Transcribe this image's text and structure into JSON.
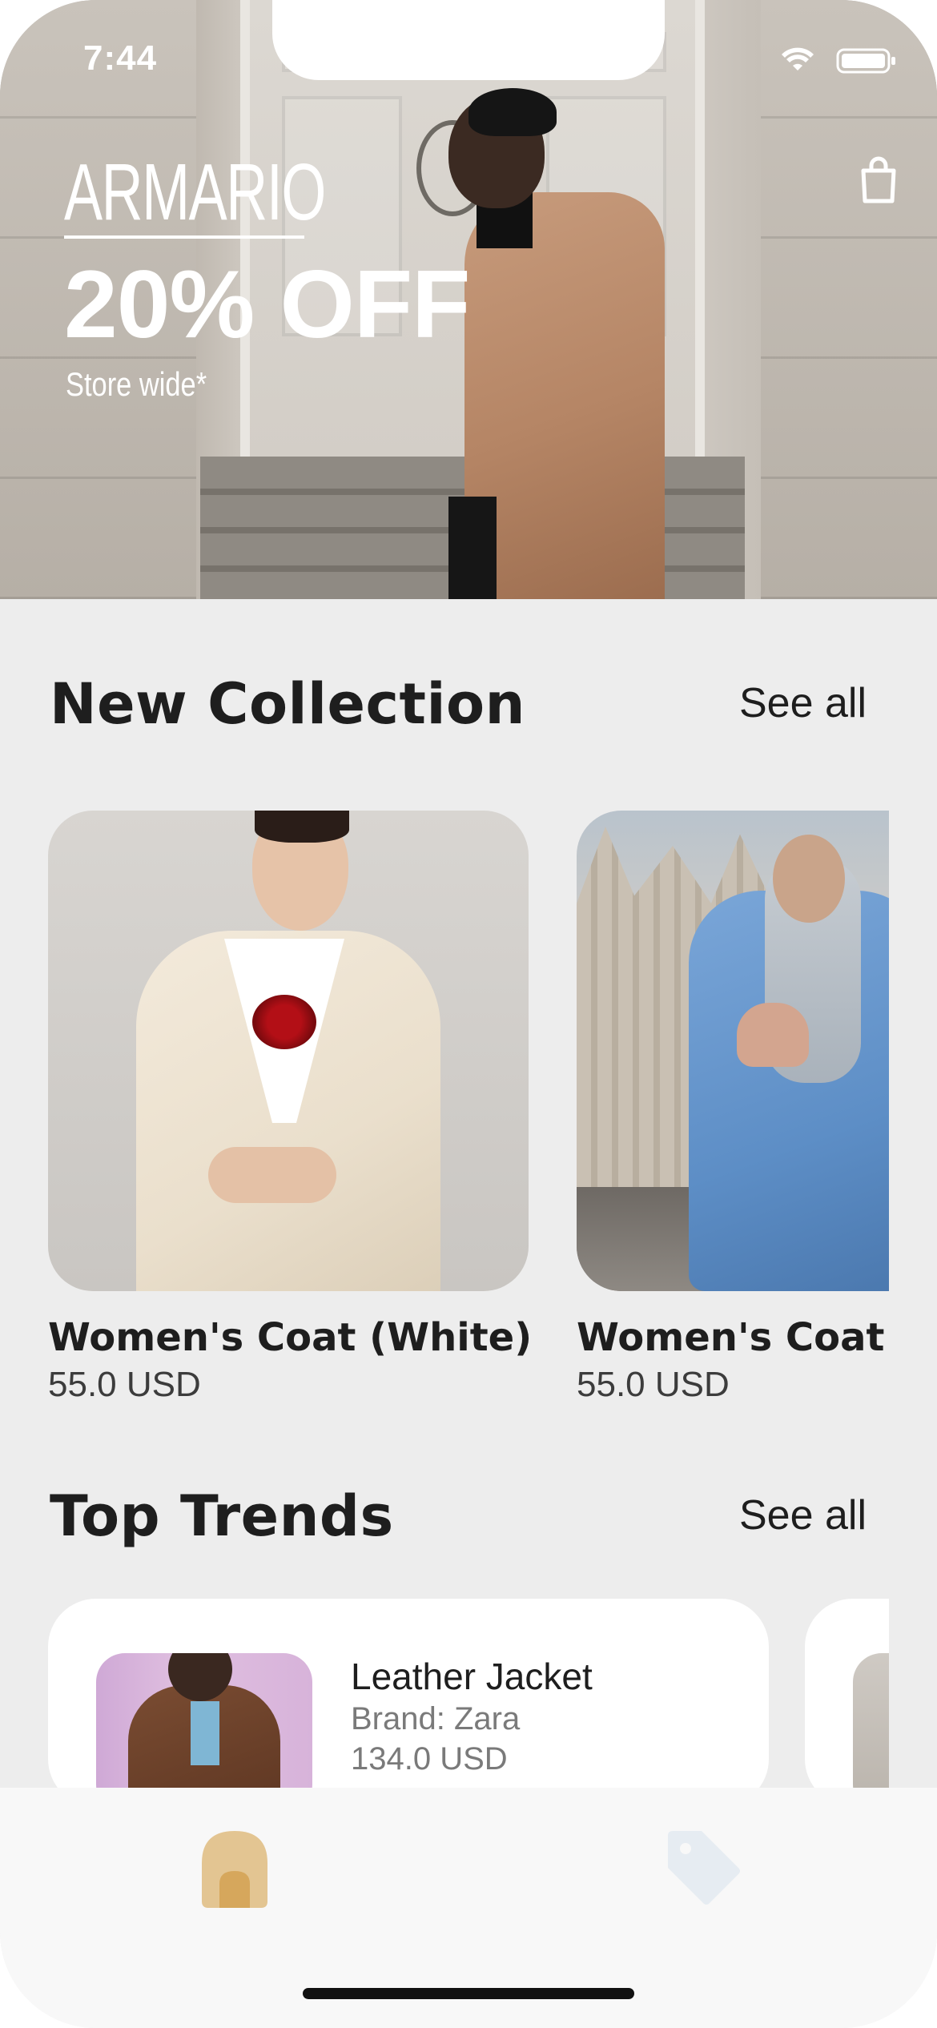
{
  "status_bar": {
    "time": "7:44"
  },
  "hero": {
    "brand": "ARMARIO",
    "headline": "20% OFF",
    "subline": "Store wide*"
  },
  "new_collection": {
    "title": "New Collection",
    "see_all": "See all",
    "items": [
      {
        "name": "Women's Coat (White)",
        "price": "55.0 USD"
      },
      {
        "name": "Women's Coat (",
        "price": "55.0 USD"
      }
    ]
  },
  "top_trends": {
    "title": "Top Trends",
    "see_all": "See all",
    "items": [
      {
        "name": "Leather Jacket",
        "brand": "Brand: Zara",
        "price": "134.0 USD"
      }
    ]
  },
  "tab_bar": {
    "tabs": [
      {
        "icon": "home-icon",
        "active": true
      },
      {
        "icon": "tag-icon",
        "active": false
      }
    ]
  },
  "colors": {
    "background": "#ededed",
    "card": "#ffffff",
    "tab_active": "#d9b87f",
    "tab_inactive": "#e5ebf1"
  }
}
